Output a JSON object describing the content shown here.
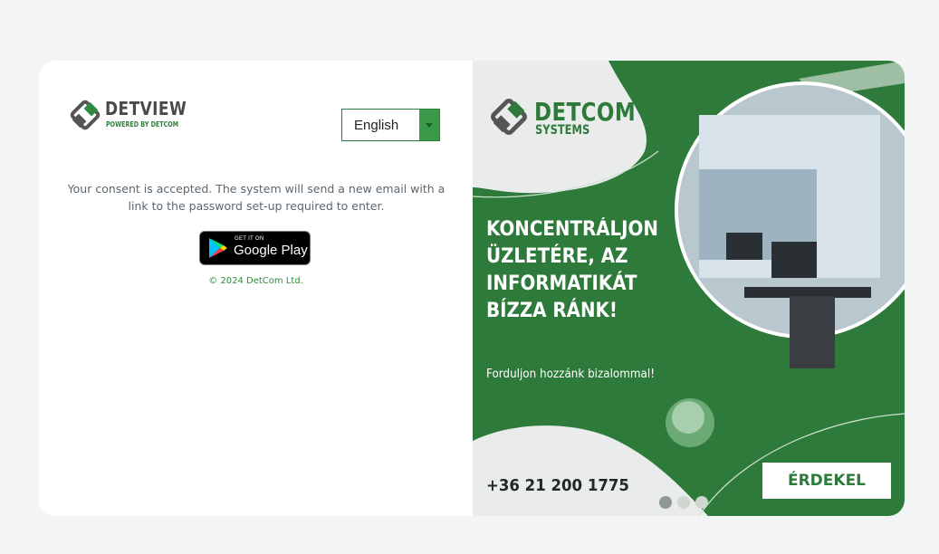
{
  "left_panel": {
    "logo": {
      "title": "DETVIEW",
      "subtitle": "POWERED BY DETCOM"
    },
    "language_select": {
      "selected": "English"
    },
    "consent_message": "Your consent is accepted. The system will send a new email with a link to the password set-up required to enter.",
    "google_play": {
      "small_text": "GET IT ON",
      "big_text": "Google Play"
    },
    "copyright": "© 2024 DetCom Ltd."
  },
  "ad_panel": {
    "logo": {
      "title": "DETCOM",
      "subtitle": "SYSTEMS"
    },
    "headline": "KONCENTRÁLJON ÜZLETÉRE, AZ INFORMATIKÁT BÍZZA RÁNK!",
    "tagline": "Forduljon hozzánk bizalommal!",
    "phone": "+36 21 200 1775",
    "cta_label": "ÉRDEKEL",
    "carousel": {
      "slide_count": 3,
      "active_index": 0
    }
  },
  "colors": {
    "brand_green": "#2e7a3a",
    "page_bg": "#f3f4f6"
  },
  "icons": [
    "detview-logo-icon",
    "chevron-down-icon",
    "google-play-icon",
    "detcom-logo-icon"
  ]
}
